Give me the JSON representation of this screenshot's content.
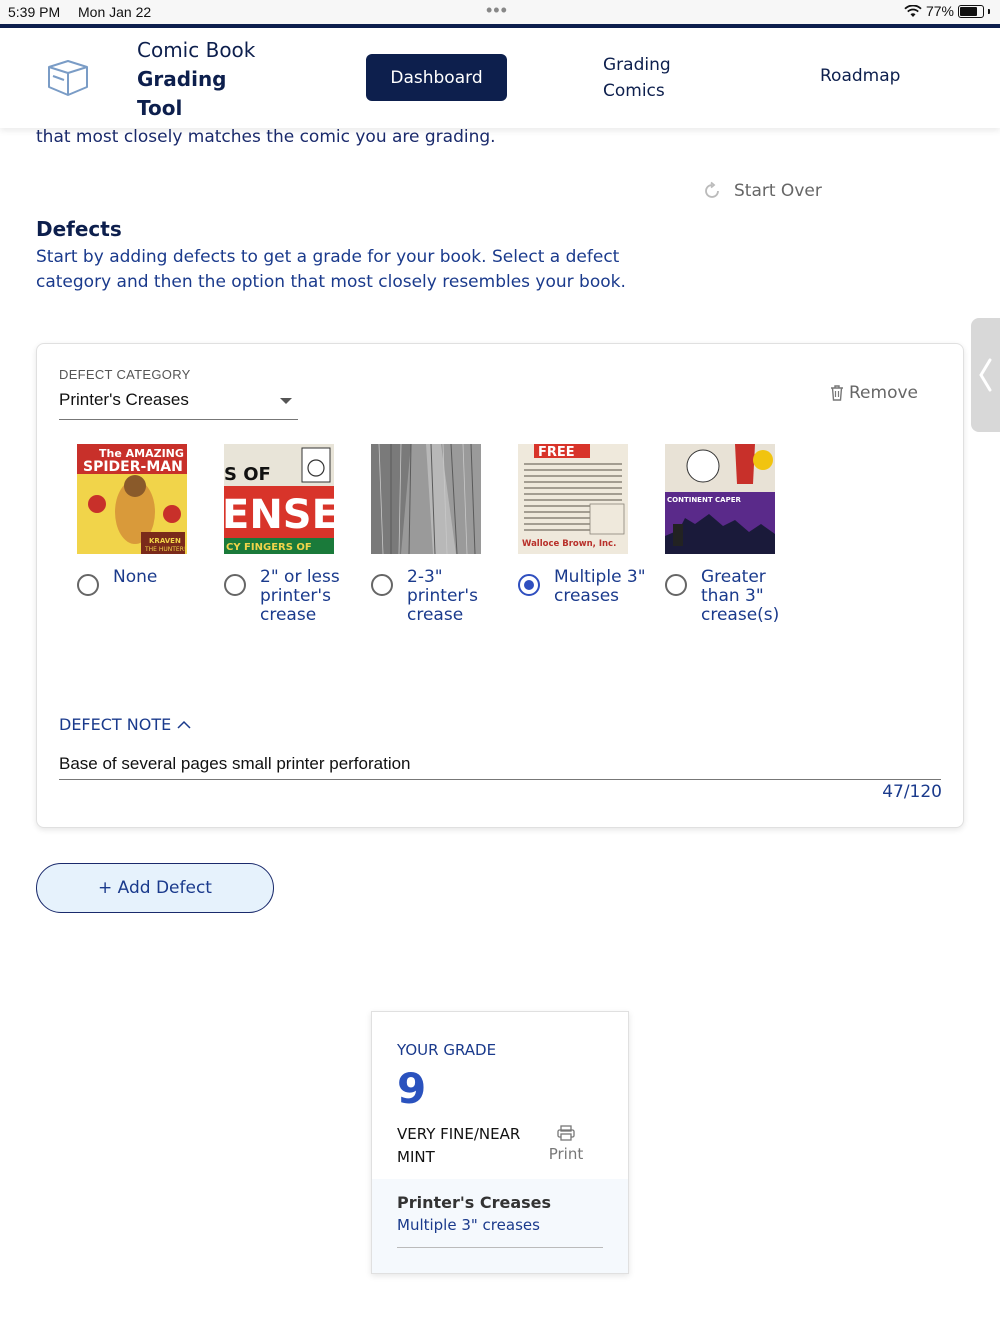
{
  "status_bar": {
    "time": "5:39 PM",
    "date": "Mon Jan 22",
    "battery": "77%"
  },
  "header": {
    "logo_line1": "Comic Book",
    "logo_line2": "Grading",
    "logo_line3": "Tool",
    "nav": {
      "dashboard": "Dashboard",
      "grading": "Grading Comics",
      "roadmap": "Roadmap"
    }
  },
  "content": {
    "intro_tail": "that most closely matches the comic you are grading.",
    "start_over": "Start Over",
    "defects_title": "Defects",
    "defects_desc": "Start by adding defects to get a grade for your book. Select a defect category and then the option that most closely resembles your book."
  },
  "defect_card": {
    "category_label": "DEFECT CATEGORY",
    "category_value": "Printer's Creases",
    "remove_label": "Remove",
    "options": [
      {
        "label": "None",
        "checked": false
      },
      {
        "label": "2\" or less printer's crease",
        "checked": false
      },
      {
        "label": "2-3\" printer's crease",
        "checked": false
      },
      {
        "label": "Multiple 3\" creases",
        "checked": true
      },
      {
        "label": "Greater than 3\" crease(s)",
        "checked": false
      }
    ],
    "thumbnail_text": {
      "t1a": "The AMAZING",
      "t1b": "SPIDER-MAN",
      "t1c": "KRAVEN",
      "t1d": "THE HUNTER!",
      "t2a": "S OF",
      "t2b": "ENSE",
      "t2c": "CY FINGERS OF",
      "t4a": "FREE",
      "t4b": "Walloce Brown, Inc.",
      "t5a": "CONTINENT CAPER"
    },
    "note_label": "DEFECT NOTE",
    "note_value": "Base of several pages small printer perforation",
    "note_count": "47/120"
  },
  "add_defect": "+ Add Defect",
  "grade_card": {
    "label": "YOUR GRADE",
    "value": "9",
    "description": "VERY FINE/NEAR MINT",
    "print": "Print",
    "detail_title": "Printer's Creases",
    "detail_sub": "Multiple 3\" creases"
  },
  "colors": {
    "navy": "#0d1f4d",
    "accent_blue": "#2a52be",
    "link_blue": "#1a3a8c",
    "add_bg": "#e6f2fc"
  }
}
